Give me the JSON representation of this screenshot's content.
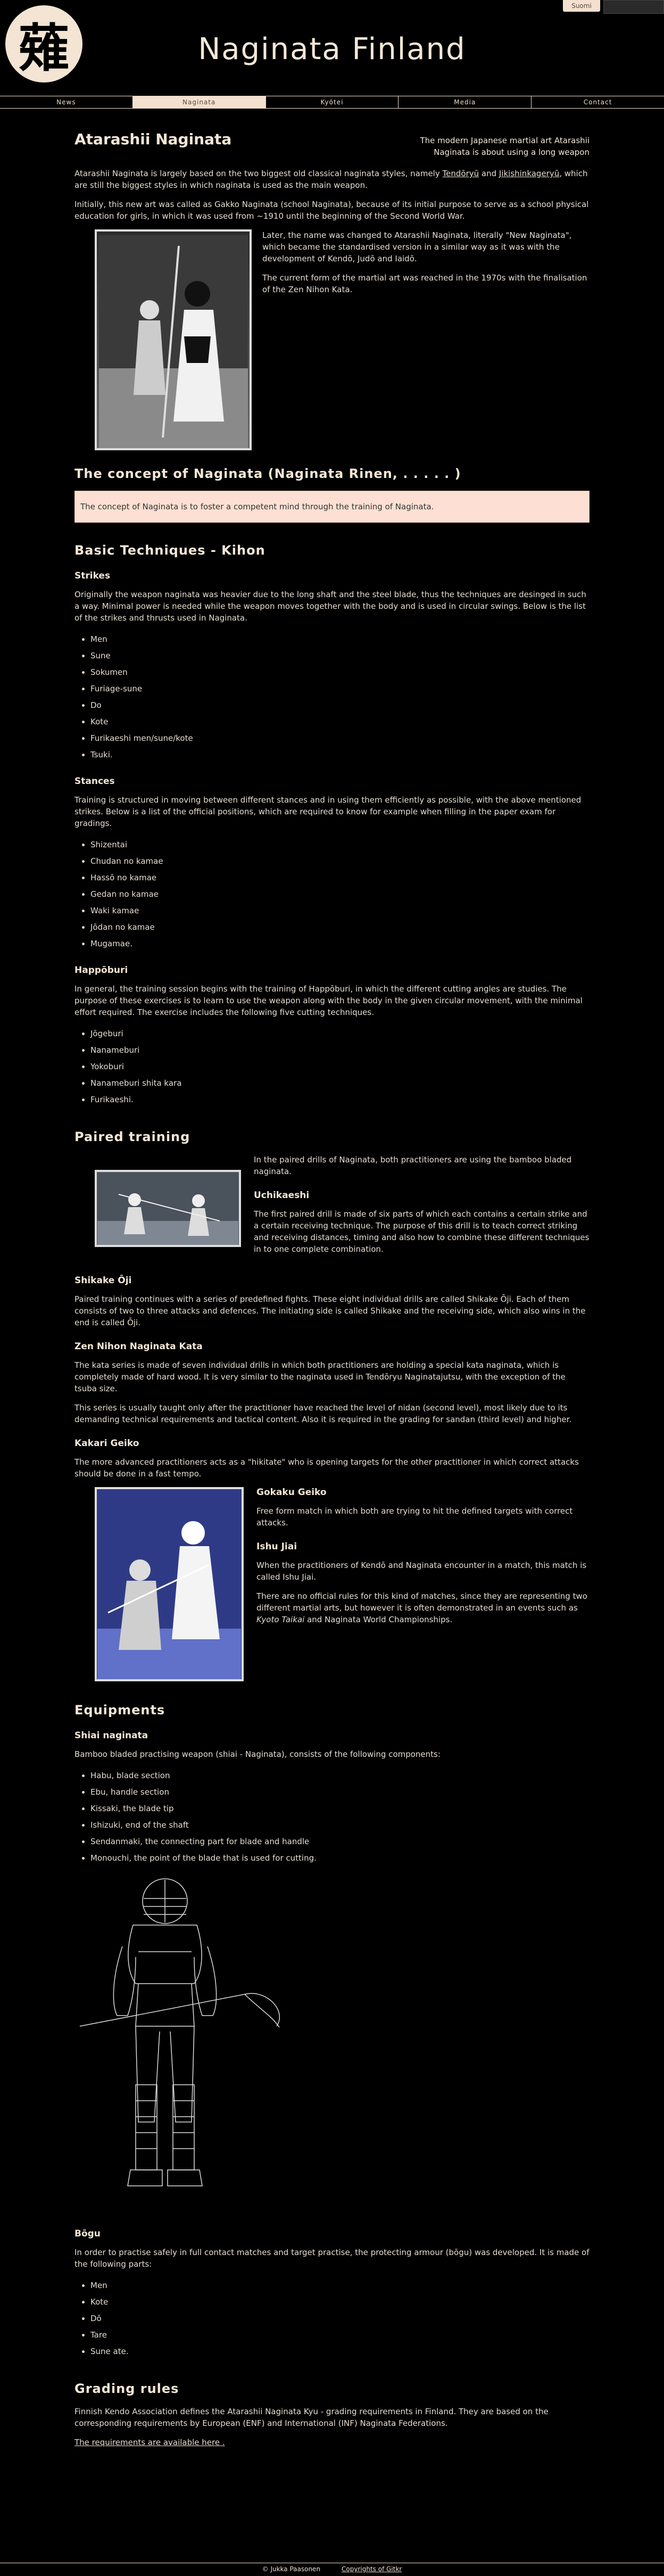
{
  "header": {
    "title": "Naginata Finland",
    "logo_glyph": "薙",
    "language_button": "Suomi"
  },
  "nav": [
    "News",
    "Naginata",
    "Kyōtei",
    "Media",
    "Contact"
  ],
  "page": {
    "title": "Atarashii Naginata",
    "tagline": "The modern Japanese martial art Atarashii Naginata is about using a long weapon",
    "intro1_pre": "Atarashii Naginata is largely based on the two biggest old classical naginata styles, namely ",
    "intro1_link1": "Tendōryū",
    "intro1_and": " and ",
    "intro1_link2": "Jikishinkageryū",
    "intro1_post": ", which are still the biggest styles in which naginata is used as the main weapon.",
    "intro2": "Initially, this new art was called as Gakko Naginata (school Naginata), because of its initial purpose to serve as a school physical education for girls, in which it was used from ~1910 until the beginning of the Second World War.",
    "side1": "Later, the name was changed to Atarashii Naginata, literally \"New Naginata\", which became the standardised version in a similar way as it was with the development of Kendō, Judō and Iaidō.",
    "side2": "The current form of the martial art was reached in the 1970s with the finalisation of the Zen Nihon Kata."
  },
  "concept": {
    "title": "The concept of Naginata (Naginata Rinen,  .  .  .  .  .  )",
    "callout": "The concept of Naginata is to foster a competent mind through the training of Naginata."
  },
  "basics": {
    "title": "Basic Techniques - Kihon",
    "strikes_title": "Strikes",
    "strikes_text": "Originally the weapon naginata was heavier due to the long shaft and the steel blade, thus the techniques are desinged in such a way. Minimal power is needed while the weapon moves together with the body and is used in circular swings. Below is the list of the strikes and thrusts used in Naginata.",
    "strikes": [
      "Men",
      "Sune",
      "Sokumen",
      "Furiage-sune",
      "Do",
      "Kote",
      "Furikaeshi men/sune/kote",
      "Tsuki."
    ],
    "stances_title": "Stances",
    "stances_text": "Training is structured in moving between different stances and in using them efficiently as possible, with the above mentioned strikes. Below is a list of the official positions, which are required to know for example when filling in the paper exam for gradings.",
    "stances": [
      "Shizentai",
      "Chudan no kamae",
      "Hassō no kamae",
      "Gedan no kamae",
      "Waki kamae",
      "Jōdan no kamae",
      "Mugamae."
    ],
    "happo_title": "Happōburi",
    "happo_text": "In general, the training session begins with the training of Happōburi, in which the different cutting angles are studies. The purpose of these exercises is to learn to use the weapon along with the body in the given circular movement, with the minimal effort required. The exercise includes the following five cutting techniques.",
    "happo": [
      "Jōgeburi",
      "Nanameburi",
      "Yokoburi",
      "Nanameburi shita kara",
      "Furikaeshi."
    ]
  },
  "paired": {
    "title": "Paired training",
    "intro": "In the paired drills of Naginata, both practitioners are using the bamboo bladed naginata.",
    "uchi_title": "Uchikaeshi",
    "uchi_text": "The first paired drill is made of six parts of which each contains a certain strike and a certain receiving technique. The purpose of this drill is to teach correct striking and receiving distances, timing and also how to combine these different techniques in to one complete combination.",
    "shikake_title": "Shikake Ōji",
    "shikake_text": "Paired training continues with a series of predefined fights. These eight individual drills are called Shikake Ōji. Each of them consists of two to three attacks and defences. The initiating side is called Shikake and the receiving side, which also wins in the end is called Ōji.",
    "kata_title": "Zen Nihon Naginata Kata",
    "kata_text1": "The kata series is made of seven individual drills in which both practitioners are holding a special kata naginata, which is completely made of hard wood. It is very similar to the naginata used in Tendōryu Naginatajutsu, with the exception of the tsuba size.",
    "kata_text2": "This series is usually taught only after the practitioner have reached the level of nidan (second level), most likely due to its demanding technical requirements and tactical content. Also it is required in the grading for sandan (third level) and higher.",
    "kakari_title": "Kakari Geiko",
    "kakari_text": "The more advanced practitioners acts as a \"hikitate\" who is opening targets for the other practitioner in which correct attacks should be done in a fast tempo.",
    "gokaku_title": "Gokaku Geiko",
    "gokaku_text": "Free form match in which both are trying to hit the defined targets with correct attacks.",
    "ishu_title": "Ishu Jiai",
    "ishu_text1": "When the practitioners of Kendō and Naginata encounter in a match, this match is called Ishu Jiai.",
    "ishu_text2_pre": "There are no official rules for this kind of matches, since they are representing two different martial arts, but however it is often demonstrated in an events such as ",
    "ishu_text2_em": "Kyoto Taikai",
    "ishu_text2_post": " and Naginata World Championships."
  },
  "equipment": {
    "title": "Equipments",
    "shiai_title": "Shiai naginata",
    "shiai_text": "Bamboo bladed practising weapon (shiai - Naginata), consists of the following components:",
    "parts": [
      "Habu, blade section",
      "Ebu, handle section",
      "Kissaki, the blade tip",
      "Ishizuki, end of the shaft",
      "Sendanmaki, the connecting part for blade and handle",
      "Monouchi, the point of the blade that is used for cutting."
    ],
    "bogu_title": "Bōgu",
    "bogu_text": "In order to practise safely in full contact matches and target practise, the protecting armour (bōgu) was developed. It is made of the following parts:",
    "bogu_parts": [
      "Men",
      "Kote",
      "Dō",
      "Tare",
      "Sune ate."
    ]
  },
  "grading": {
    "title": "Grading rules",
    "text": "Finnish Kendo Association defines the Atarashii Naginata Kyu - grading requirements in Finland. They are based on the corresponding requirements by European (ENF) and International (INF) Naginata Federations.",
    "link": "The requirements are available here ."
  },
  "footer": {
    "copyright": "© Jukka Paasonen",
    "credits": "Copyrights of Gitkr"
  }
}
